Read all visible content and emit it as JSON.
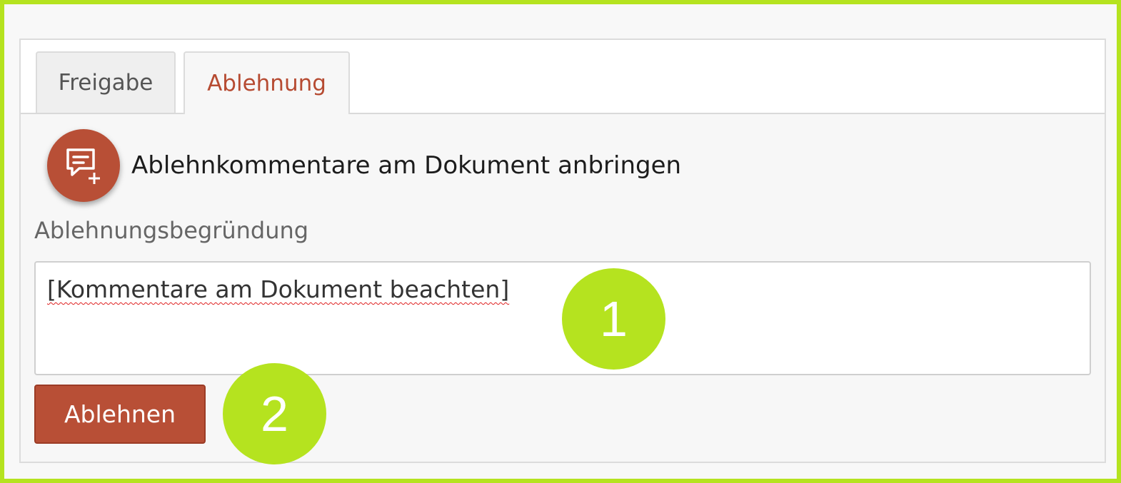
{
  "tabs": [
    {
      "label": "Freigabe",
      "active": false
    },
    {
      "label": "Ablehnung",
      "active": true
    }
  ],
  "comment_action": {
    "icon": "comment-add-icon",
    "label": "Ablehnkommentare am Dokument anbringen"
  },
  "reason": {
    "label": "Ablehnungsbegründung",
    "value": "[Kommentare am Dokument beachten]"
  },
  "reject_button": {
    "label": "Ablehnen"
  },
  "markers": [
    {
      "label": "1"
    },
    {
      "label": "2"
    }
  ],
  "colors": {
    "accent": "#b84f36",
    "highlight": "#b5e31f"
  }
}
